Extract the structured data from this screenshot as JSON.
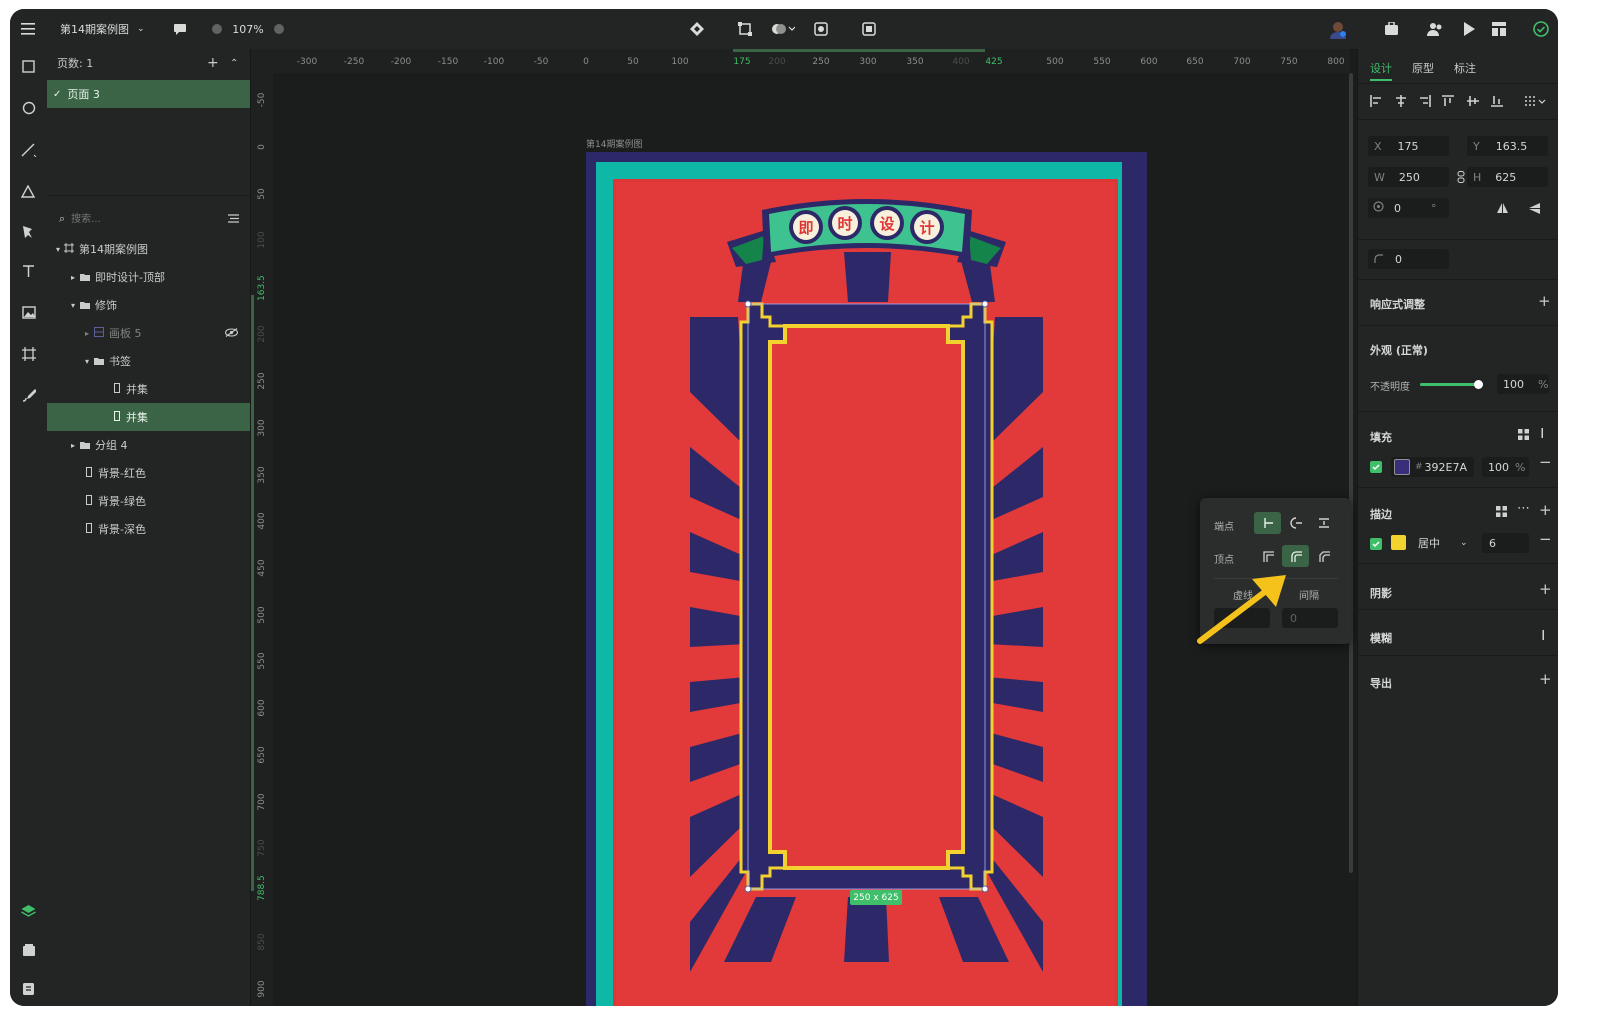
{
  "topbar": {
    "file_name": "第14期案例图",
    "zoom": "107%"
  },
  "layers": {
    "pages_label": "页数: 1",
    "pages": [
      {
        "label": "页面 3"
      }
    ],
    "search_placeholder": "搜索...",
    "tree": [
      {
        "label": "第14期案例图"
      },
      {
        "label": "即时设计-顶部"
      },
      {
        "label": "修饰"
      },
      {
        "label": "画板 5"
      },
      {
        "label": "书签"
      },
      {
        "label": "并集"
      },
      {
        "label": "并集"
      },
      {
        "label": "分组 4"
      },
      {
        "label": "背景-红色"
      },
      {
        "label": "背景-绿色"
      },
      {
        "label": "背景-深色"
      }
    ]
  },
  "ruler": {
    "h_ticks": [
      "-300",
      "-250",
      "-200",
      "-150",
      "-100",
      "-50",
      "0",
      "50",
      "100",
      "175",
      "200",
      "250",
      "300",
      "350",
      "400",
      "425",
      "500",
      "550",
      "600",
      "650",
      "700",
      "750",
      "800"
    ],
    "v_ticks": [
      "-50",
      "0",
      "50",
      "100",
      "163.5",
      "200",
      "250",
      "300",
      "350",
      "400",
      "450",
      "500",
      "550",
      "600",
      "650",
      "700",
      "750",
      "788.5",
      "850",
      "900"
    ]
  },
  "canvas": {
    "artboard_label": "第14期案例图",
    "badge_chars": [
      "即",
      "时",
      "设",
      "计"
    ],
    "size_badge": "250 x 625"
  },
  "design": {
    "tabs": [
      "设计",
      "原型",
      "标注"
    ],
    "x_label": "X",
    "x": "175",
    "y_label": "Y",
    "y": "163.5",
    "w_label": "W",
    "w": "250",
    "h_label": "H",
    "h": "625",
    "rotation": "0",
    "rotation_unit": "°",
    "radius": "0",
    "responsive_label": "响应式调整",
    "appearance_label": "外观 (正常)",
    "opacity_label": "不透明度",
    "opacity": "100",
    "opacity_unit": "%",
    "opacity_level": 100,
    "fill_label": "填充",
    "fill_hex": "392E7A",
    "fill_opacity": "100",
    "fill_unit": "%",
    "stroke_label": "描边",
    "stroke_position": "居中",
    "stroke_width": "6",
    "shadow_label": "阴影",
    "blur_label": "模糊",
    "export_label": "导出"
  },
  "stroke_popup": {
    "endpoint_label": "端点",
    "corner_label": "顶点",
    "dash_label": "虚线",
    "gap_label": "间隔",
    "gap_value": "0"
  },
  "colors": {
    "accent": "#3b6446",
    "fill": "#392E7A",
    "stroke": "#F2D22E",
    "poster_red": "#E03535",
    "poster_teal": "#0FB8A6",
    "arrow": "#F5C21B"
  }
}
